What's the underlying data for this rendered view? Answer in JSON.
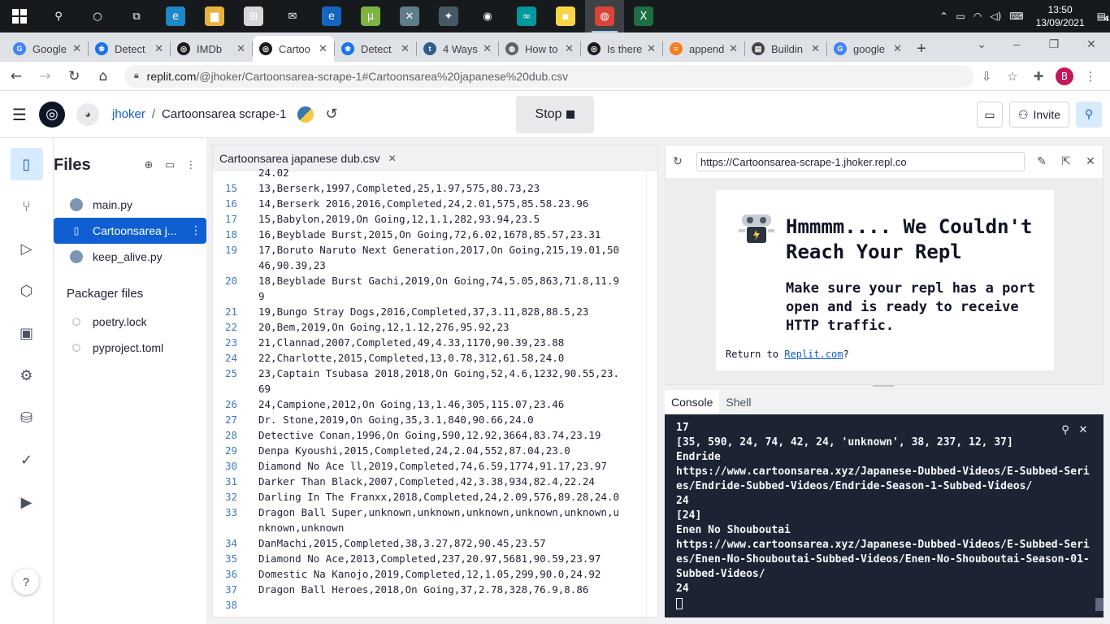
{
  "taskbar": {
    "apps": [
      {
        "name": "search-icon",
        "glyph": "⚲",
        "color": "#171a1c"
      },
      {
        "name": "cortana-icon",
        "glyph": "○",
        "color": "#171a1c"
      },
      {
        "name": "task-view-icon",
        "glyph": "⧉",
        "color": "#171a1c"
      },
      {
        "name": "edge-icon",
        "glyph": "e",
        "color": "#1e88c8"
      },
      {
        "name": "file-explorer-icon",
        "glyph": "▆",
        "color": "#e8b33c"
      },
      {
        "name": "store-icon",
        "glyph": "⊞",
        "color": "#d7d7d7"
      },
      {
        "name": "mail-icon",
        "glyph": "✉",
        "color": "#171a1c"
      },
      {
        "name": "ie-icon",
        "glyph": "e",
        "color": "#1565c0"
      },
      {
        "name": "utorrent-icon",
        "glyph": "µ",
        "color": "#7cb342"
      },
      {
        "name": "vm-icon",
        "glyph": "✕",
        "color": "#607d8b"
      },
      {
        "name": "star-icon",
        "glyph": "✦",
        "color": "#455a64"
      },
      {
        "name": "obs-icon",
        "glyph": "◉",
        "color": "#171a1c"
      },
      {
        "name": "arduino-icon",
        "glyph": "∞",
        "color": "#00979d"
      },
      {
        "name": "sticky-notes-icon",
        "glyph": "▪",
        "color": "#f7d547"
      },
      {
        "name": "chrome-icon",
        "glyph": "◍",
        "color": "#db4437"
      },
      {
        "name": "excel-icon",
        "glyph": "X",
        "color": "#1d7044"
      }
    ],
    "tray": {
      "time": "13:50",
      "date": "13/09/2021",
      "notifications": "4"
    }
  },
  "browser": {
    "tabs": [
      {
        "title": "Google",
        "color": "#4285f4",
        "glyph": "G"
      },
      {
        "title": "Detect",
        "color": "#1a73e8",
        "glyph": "❀"
      },
      {
        "title": "IMDb",
        "color": "#1d1d1d",
        "glyph": "◎"
      },
      {
        "title": "Cartoo",
        "color": "#1d1d1d",
        "glyph": "◎",
        "active": true
      },
      {
        "title": "Detect",
        "color": "#1a73e8",
        "glyph": "❀"
      },
      {
        "title": "4 Ways",
        "color": "#2f5d8a",
        "glyph": "t"
      },
      {
        "title": "How to",
        "color": "#5f6368",
        "glyph": "◍"
      },
      {
        "title": "Is there",
        "color": "#1d1d1d",
        "glyph": "◎"
      },
      {
        "title": "append",
        "color": "#f48024",
        "glyph": "≡"
      },
      {
        "title": "Buildin",
        "color": "#444",
        "glyph": "▤"
      },
      {
        "title": "google",
        "color": "#4285f4",
        "glyph": "G"
      }
    ],
    "address": {
      "host": "replit.com",
      "path": "/@jhoker/Cartoonsarea-scrape-1#Cartoonsarea%20japanese%20dub.csv"
    },
    "profile_initial": "B"
  },
  "header": {
    "user": "jhoker",
    "separator": "/",
    "project": "Cartoonsarea scrape-1",
    "stop_label": "Stop",
    "invite_label": "Invite"
  },
  "files": {
    "title": "Files",
    "items": [
      {
        "label": "main.py",
        "type": "py"
      },
      {
        "label": "Cartoonsarea j...",
        "type": "csv",
        "active": true
      },
      {
        "label": "keep_alive.py",
        "type": "py"
      }
    ],
    "packager_title": "Packager files",
    "packager_items": [
      {
        "label": "poetry.lock"
      },
      {
        "label": "pyproject.toml"
      }
    ]
  },
  "editor": {
    "tab_label": "Cartoonsarea japanese dub.csv",
    "lines": [
      {
        "n": "",
        "t": "24.02"
      },
      {
        "n": "15",
        "t": "13,Berserk,1997,Completed,25,1.97,575,80.73,23"
      },
      {
        "n": "16",
        "t": "14,Berserk 2016,2016,Completed,24,2.01,575,85.58.23.96"
      },
      {
        "n": "17",
        "t": "15,Babylon,2019,On Going,12,1.1,282,93.94,23.5"
      },
      {
        "n": "18",
        "t": "16,Beyblade Burst,2015,On Going,72,6.02,1678,85.57,23.31"
      },
      {
        "n": "19",
        "t": "17,Boruto Naruto Next Generation,2017,On Going,215,19.01,5046,90.39,23"
      },
      {
        "n": "20",
        "t": "18,Beyblade Burst Gachi,2019,On Going,74,5.05,863,71.8,11.99"
      },
      {
        "n": "21",
        "t": "19,Bungo Stray Dogs,2016,Completed,37,3.11,828,88.5,23"
      },
      {
        "n": "22",
        "t": "20,Bem,2019,On Going,12,1.12,276,95.92,23"
      },
      {
        "n": "23",
        "t": "21,Clannad,2007,Completed,49,4.33,1170,90.39,23.88"
      },
      {
        "n": "24",
        "t": "22,Charlotte,2015,Completed,13,0.78,312,61.58,24.0"
      },
      {
        "n": "25",
        "t": "23,Captain Tsubasa 2018,2018,On Going,52,4.6,1232,90.55,23.69"
      },
      {
        "n": "26",
        "t": "24,Campione,2012,On Going,13,1.46,305,115.07,23.46"
      },
      {
        "n": "27",
        "t": "Dr. Stone,2019,On Going,35,3.1,840,90.66,24.0"
      },
      {
        "n": "28",
        "t": "Detective Conan,1996,On Going,590,12.92,3664,83.74,23.19"
      },
      {
        "n": "29",
        "t": "Denpa Kyoushi,2015,Completed,24,2.04,552,87.04,23.0"
      },
      {
        "n": "30",
        "t": "Diamond No Ace ll,2019,Completed,74,6.59,1774,91.17,23.97"
      },
      {
        "n": "31",
        "t": "Darker Than Black,2007,Completed,42,3.38,934,82.4,22.24"
      },
      {
        "n": "32",
        "t": "Darling In The Franxx,2018,Completed,24,2.09,576,89.28,24.0"
      },
      {
        "n": "33",
        "t": "Dragon Ball Super,unknown,unknown,unknown,unknown,unknown,unknown,unknown"
      },
      {
        "n": "34",
        "t": "DanMachi,2015,Completed,38,3.27,872,90.45,23.57"
      },
      {
        "n": "35",
        "t": "Diamond No Ace,2013,Completed,237,20.97,5681,90.59,23.97"
      },
      {
        "n": "36",
        "t": "Domestic Na Kanojo,2019,Completed,12,1.05,299,90.0,24.92"
      },
      {
        "n": "37",
        "t": "Dragon Ball Heroes,2018,On Going,37,2.78,328,76.9,8.86"
      },
      {
        "n": "38",
        "t": ""
      }
    ]
  },
  "webview": {
    "url": "https://Cartoonsarea-scrape-1.jhoker.repl.co",
    "title": "Hmmmm.... We Couldn't Reach Your Repl",
    "body": "Make sure your repl has a port open and is ready to receive HTTP traffic.",
    "return_prefix": "Return to ",
    "return_link": "Replit.com",
    "return_suffix": "?"
  },
  "console": {
    "tabs": [
      {
        "label": "Console",
        "active": true
      },
      {
        "label": "Shell"
      }
    ],
    "output": "17\n[35, 590, 24, 74, 42, 24, 'unknown', 38, 237, 12, 37]\nEndride\nhttps://www.cartoonsarea.xyz/Japanese-Dubbed-Videos/E-Subbed-Series/Endride-Subbed-Videos/Endride-Season-1-Subbed-Videos/\n24\n[24]\nEnen No Shouboutai\nhttps://www.cartoonsarea.xyz/Japanese-Dubbed-Videos/E-Subbed-Series/Enen-No-Shouboutai-Subbed-Videos/Enen-No-Shouboutai-Season-01-Subbed-Videos/\n24"
  }
}
